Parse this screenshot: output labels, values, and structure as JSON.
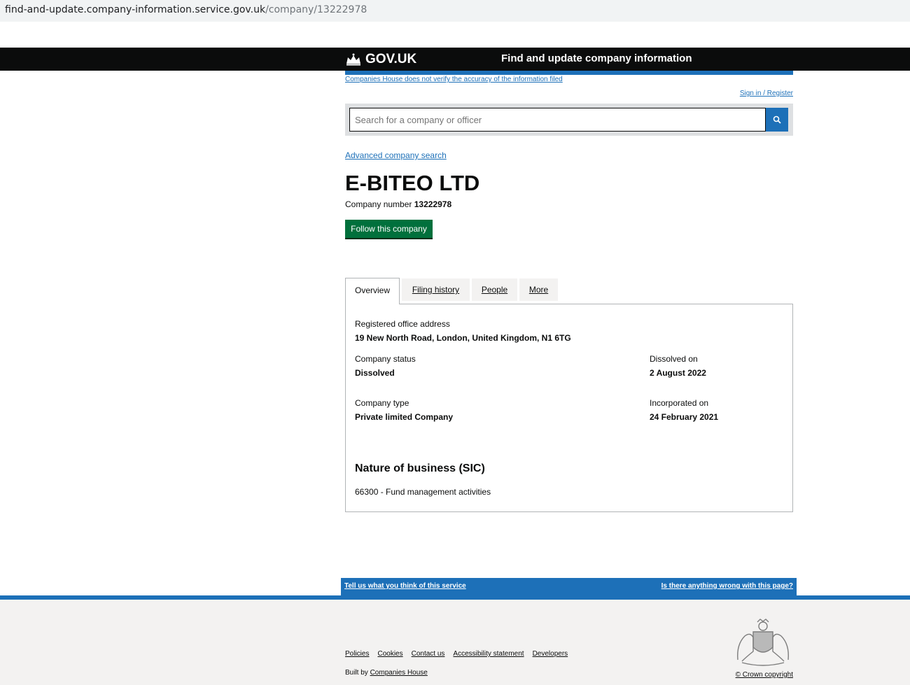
{
  "browser": {
    "url_host": "find-and-update.company-information.service.gov.uk",
    "url_path": "/company/13222978"
  },
  "header": {
    "logo_text": "GOV.UK",
    "service_name": "Find and update company information"
  },
  "disclaimer": "Companies House does not verify the accuracy of the information filed",
  "signin": "Sign in / Register",
  "search": {
    "placeholder": "Search for a company or officer",
    "button_icon": "search-icon"
  },
  "advanced_search": "Advanced company search",
  "company": {
    "name": "E-BITEO LTD",
    "number_label": "Company number",
    "number": "13222978",
    "follow_label": "Follow this company"
  },
  "tabs": [
    {
      "label": "Overview",
      "active": true
    },
    {
      "label": "Filing history",
      "active": false
    },
    {
      "label": "People",
      "active": false
    },
    {
      "label": "More",
      "active": false
    }
  ],
  "overview": {
    "address_label": "Registered office address",
    "address": "19 New North Road, London, United Kingdom, N1 6TG",
    "status_label": "Company status",
    "status": "Dissolved",
    "dissolved_label": "Dissolved on",
    "dissolved": "2 August 2022",
    "type_label": "Company type",
    "type": "Private limited Company",
    "incorporated_label": "Incorporated on",
    "incorporated": "24 February 2021",
    "sic_title": "Nature of business (SIC)",
    "sic_item": "66300 - Fund management activities"
  },
  "feedback": {
    "left": "Tell us what you think of this service",
    "right": "Is there anything wrong with this page?"
  },
  "footer": {
    "links": [
      "Policies",
      "Cookies",
      "Contact us",
      "Accessibility statement",
      "Developers"
    ],
    "built_by": "Built by",
    "built_by_link": "Companies House",
    "copyright": "© Crown copyright"
  },
  "colors": {
    "link": "#1d70b8",
    "header_bg": "#0b0c0c",
    "follow_button": "#00703c",
    "footer_bg": "#f3f2f1"
  }
}
